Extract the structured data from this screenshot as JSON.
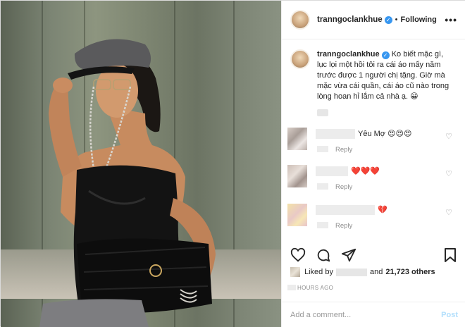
{
  "post": {
    "username": "tranngoclankhue",
    "follow_status": "Following",
    "more_label": "•••",
    "caption_username": "tranngoclankhue",
    "caption_text": "Ko biết mặc gì, lục lọi một hồi tôi ra cái áo mấy năm trước được 1 người chị tặng. Giờ mà mặc vừa cái quần, cái áo cũ nào trong lòng hoan hỉ lắm cả nhà ạ. 😀"
  },
  "comments": [
    {
      "text": "Yêu Mợ 😍😍😍",
      "reply_label": "Reply",
      "heart": "♡"
    },
    {
      "text": "❤️❤️❤️",
      "reply_label": "Reply",
      "heart": "♡"
    },
    {
      "text": "💔",
      "reply_label": "Reply",
      "heart": "♡"
    }
  ],
  "likes": {
    "prefix": "Liked by",
    "middle": "and",
    "count_text": "21,723 others"
  },
  "time_ago": "HOURS AGO",
  "comment_box": {
    "placeholder": "Add a comment...",
    "post_label": "Post"
  },
  "colors": {
    "accent": "#3897f0",
    "post_disabled": "#b2dffc",
    "heart_red": "#ed4956"
  }
}
